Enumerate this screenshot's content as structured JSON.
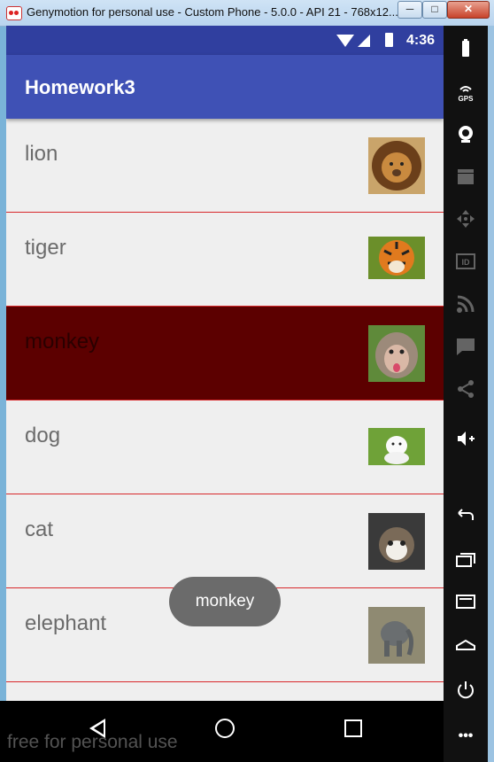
{
  "window": {
    "title": "Genymotion for personal use - Custom Phone - 5.0.0 - API 21 - 768x12...",
    "min": "─",
    "max": "□",
    "close": "✕"
  },
  "status": {
    "time": "4:36"
  },
  "appbar": {
    "title": "Homework3"
  },
  "list": {
    "items": [
      {
        "label": "lion",
        "icon": "lion-thumbnail",
        "selected": false
      },
      {
        "label": "tiger",
        "icon": "tiger-thumbnail",
        "selected": false
      },
      {
        "label": "monkey",
        "icon": "monkey-thumbnail",
        "selected": true
      },
      {
        "label": "dog",
        "icon": "dog-thumbnail",
        "selected": false
      },
      {
        "label": "cat",
        "icon": "cat-thumbnail",
        "selected": false
      },
      {
        "label": "elephant",
        "icon": "elephant-thumbnail",
        "selected": false
      }
    ]
  },
  "toast": {
    "text": "monkey"
  },
  "watermark": "free for personal use",
  "sidebar": {
    "gps_label": "GPS",
    "id_label": "ID",
    "more_label": "•••"
  },
  "colors": {
    "appbar": "#3f51b5",
    "statusbar": "#303f9f",
    "divider": "#d8282b",
    "selected_row": "#5c0000"
  }
}
